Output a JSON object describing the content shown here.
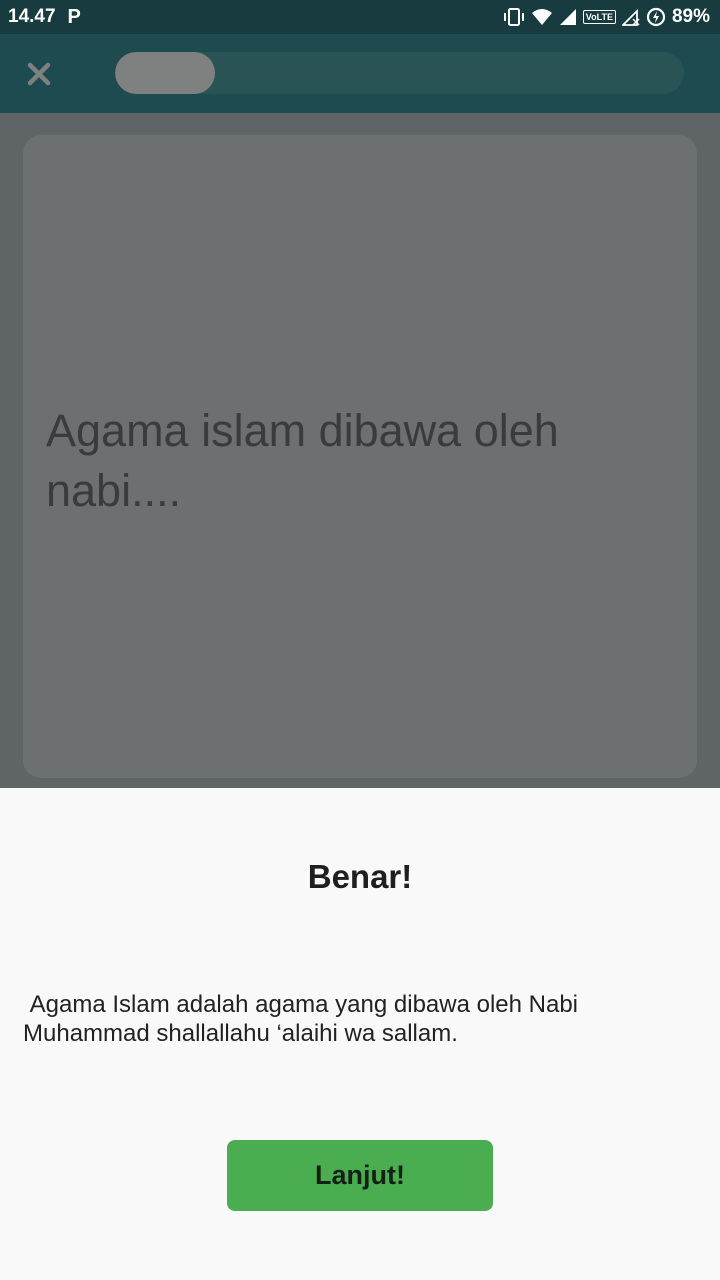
{
  "status_bar": {
    "time": "14.47",
    "notification_icon": "P",
    "volte_label": "VoLTE",
    "battery_percent": "89%",
    "icons": [
      "vibrate-icon",
      "wifi-icon",
      "signal-icon",
      "volte-icon",
      "signal-no-data-icon",
      "battery-saver-icon"
    ]
  },
  "app_bar": {
    "close_icon": "close-icon",
    "progress_fraction": 0.175
  },
  "question": {
    "text": "Agama islam dibawa oleh nabi...."
  },
  "result_sheet": {
    "title": "Benar!",
    "message": " Agama Islam adalah agama yang dibawa oleh Nabi\nMuhammad shallallahu ‘alaihi wa sallam.",
    "button_label": "Lanjut!"
  },
  "colors": {
    "app_bar": "#1d4b4f",
    "status_bar": "#173b3e",
    "scrim": "#5f6566",
    "card": "#6c7070",
    "button": "#4aae50"
  }
}
